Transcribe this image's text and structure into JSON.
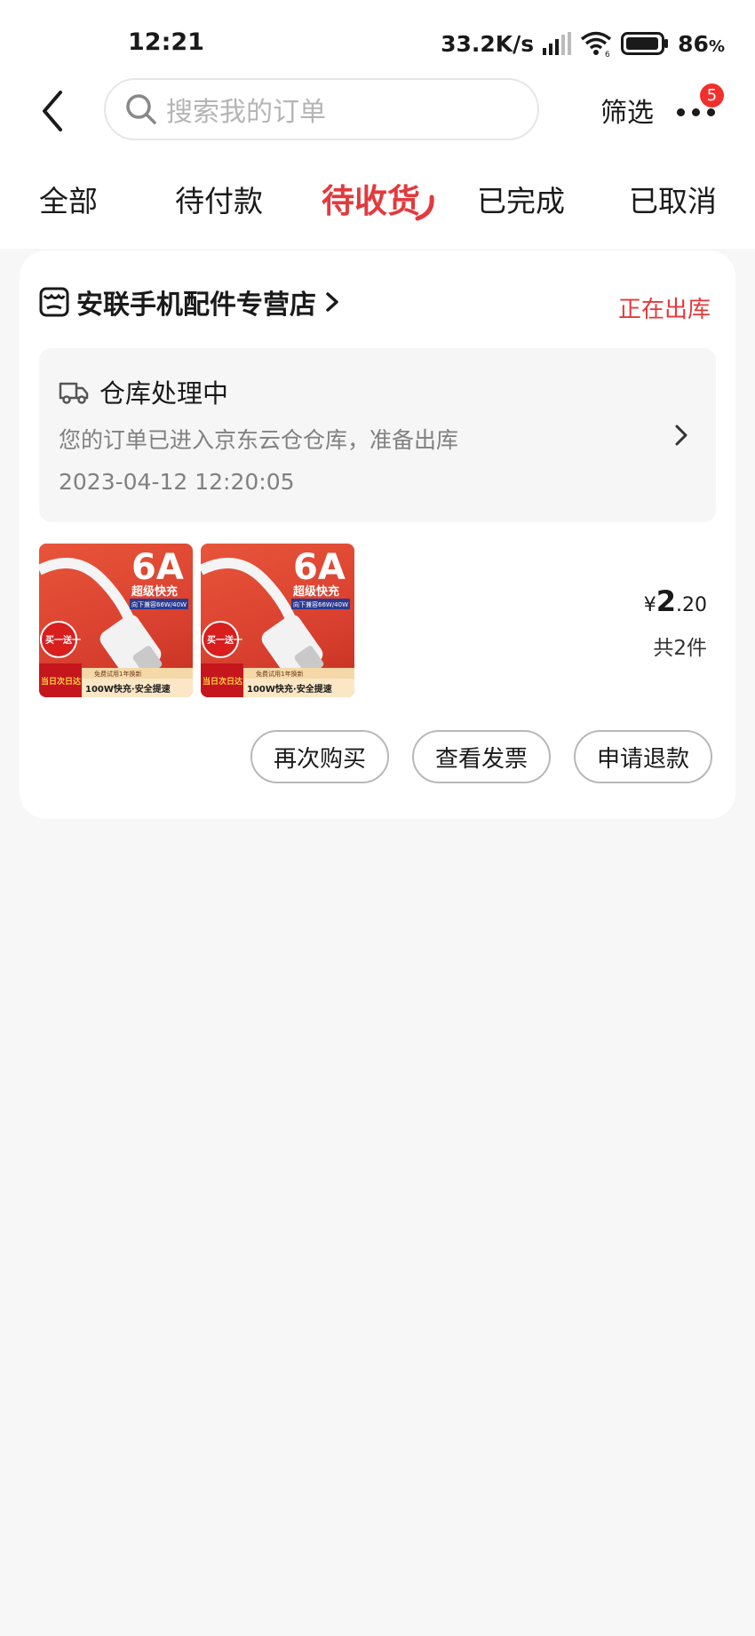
{
  "status_bar": {
    "time": "12:21",
    "net_speed": "33.2K/s",
    "battery_percent": "86",
    "battery_unit": "%"
  },
  "header": {
    "search_placeholder": "搜索我的订单",
    "filter_label": "筛选",
    "more_badge": "5"
  },
  "tabs": [
    {
      "label": "全部"
    },
    {
      "label": "待付款"
    },
    {
      "label": "待收货",
      "active": true
    },
    {
      "label": "已完成"
    },
    {
      "label": "已取消"
    }
  ],
  "order": {
    "store_name": "安联手机配件专营店",
    "status": "正在出库",
    "logistics": {
      "title": "仓库处理中",
      "description": "您的订单已进入京东云仓仓库，准备出库",
      "time": "2023-04-12 12:20:05"
    },
    "product_image_text": {
      "big": "6A",
      "line1": "超级快充",
      "line2": "向下兼容66W/40W",
      "promo": "买一送一",
      "delivery": "当日次日达",
      "trial": "免费试用1年换新",
      "bottom": "100W快充·安全提速"
    },
    "price": {
      "currency": "¥",
      "integer": "2",
      "decimal": ".20"
    },
    "quantity": "共2件",
    "actions": [
      "再次购买",
      "查看发票",
      "申请退款"
    ]
  },
  "colors": {
    "accent": "#e4393c",
    "badge": "#f0302c",
    "background": "#f7f7f7"
  }
}
